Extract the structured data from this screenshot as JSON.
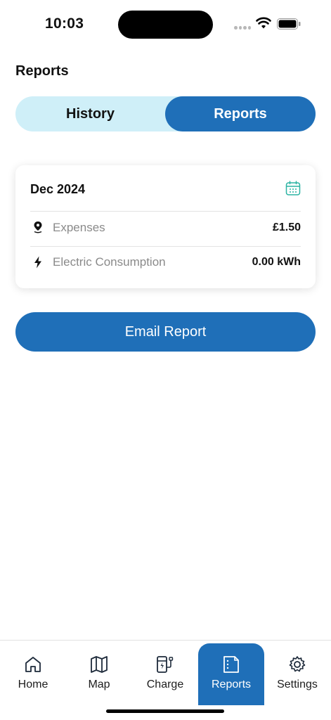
{
  "status_bar": {
    "time": "10:03"
  },
  "page": {
    "title": "Reports"
  },
  "segmented": {
    "history_label": "History",
    "reports_label": "Reports",
    "selected": "Reports"
  },
  "card": {
    "month": "Dec 2024",
    "rows": [
      {
        "icon": "location-pin-icon",
        "label": "Expenses",
        "value": "£1.50"
      },
      {
        "icon": "lightning-bolt-icon",
        "label": "Electric Consumption",
        "value": "0.00 kWh"
      }
    ]
  },
  "email_button": {
    "label": "Email Report"
  },
  "tabbar": {
    "items": [
      {
        "label": "Home",
        "icon": "home-icon"
      },
      {
        "label": "Map",
        "icon": "map-icon"
      },
      {
        "label": "Charge",
        "icon": "charger-icon"
      },
      {
        "label": "Reports",
        "icon": "reports-icon"
      },
      {
        "label": "Settings",
        "icon": "gear-icon"
      }
    ],
    "active": "Reports"
  },
  "colors": {
    "primary": "#1f6fb8",
    "segment_bg": "#cfeff8",
    "calendar_accent": "#2bb3a3"
  }
}
